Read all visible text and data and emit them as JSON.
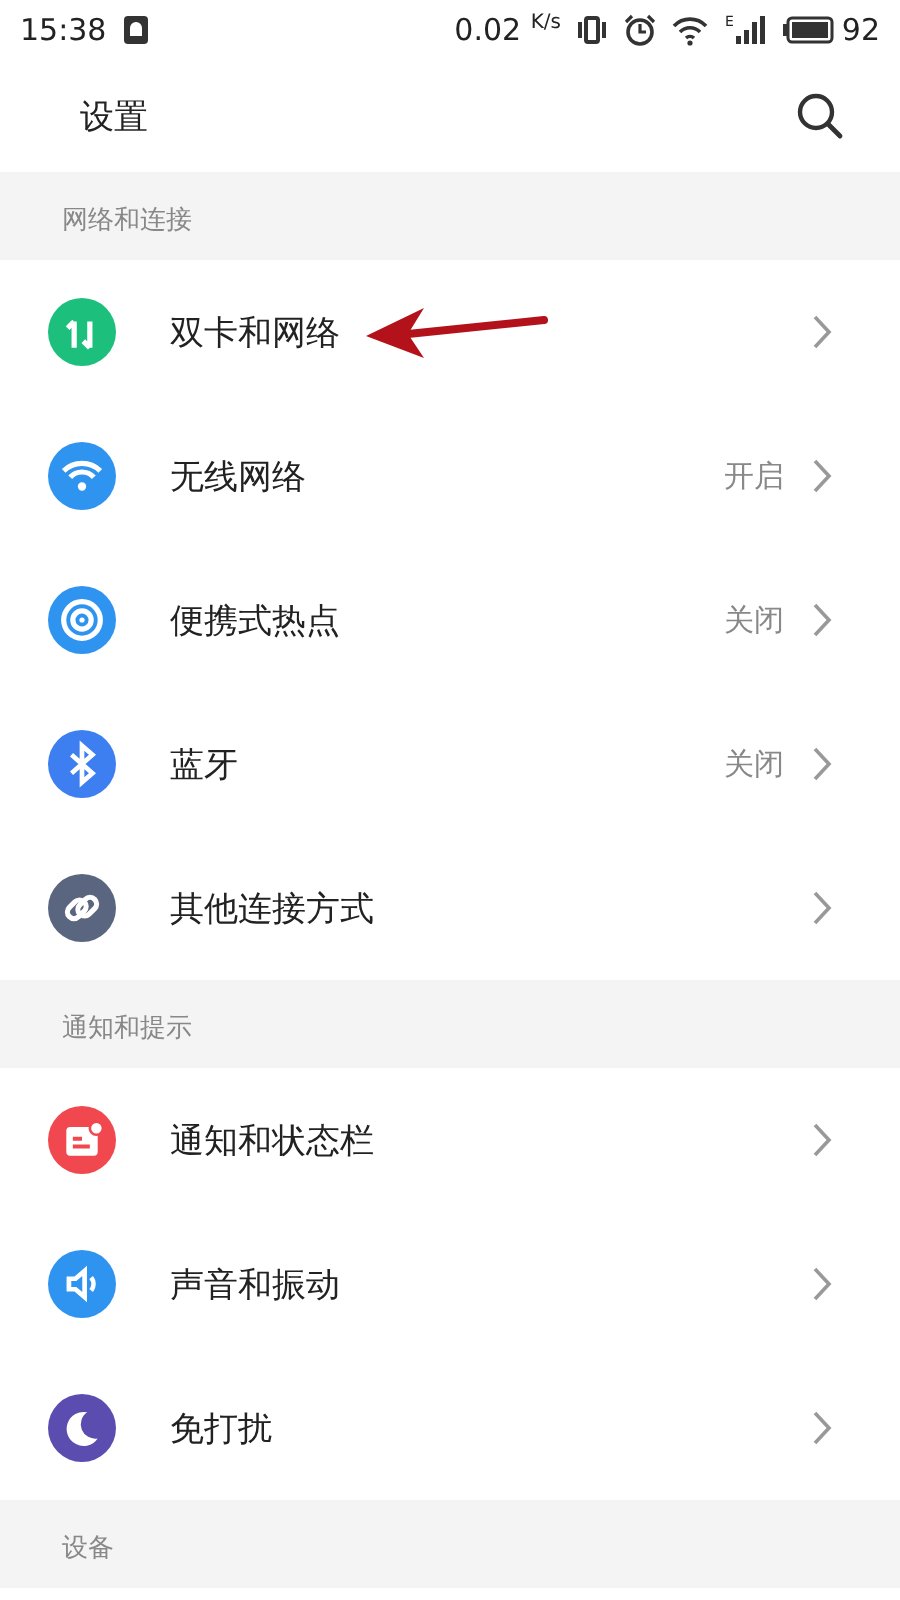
{
  "status_bar": {
    "time": "15:38",
    "speed": "0.02",
    "speed_unit": "K/s",
    "network_type": "E",
    "battery": "92"
  },
  "header": {
    "title": "设置"
  },
  "sections": [
    {
      "title": "网络和连接",
      "items": [
        {
          "label": "双卡和网络",
          "color": "#1dbf7d",
          "pointed": true
        },
        {
          "label": "无线网络",
          "color": "#2e94f0",
          "value": "开启"
        },
        {
          "label": "便携式热点",
          "color": "#2e94f0",
          "value": "关闭"
        },
        {
          "label": "蓝牙",
          "color": "#3d7ef0",
          "value": "关闭"
        },
        {
          "label": "其他连接方式",
          "color": "#5a6580"
        }
      ]
    },
    {
      "title": "通知和提示",
      "items": [
        {
          "label": "通知和状态栏",
          "color": "#f0484e"
        },
        {
          "label": "声音和振动",
          "color": "#2e94f0"
        },
        {
          "label": "免打扰",
          "color": "#5b4cb0"
        }
      ]
    },
    {
      "title": "设备"
    }
  ]
}
